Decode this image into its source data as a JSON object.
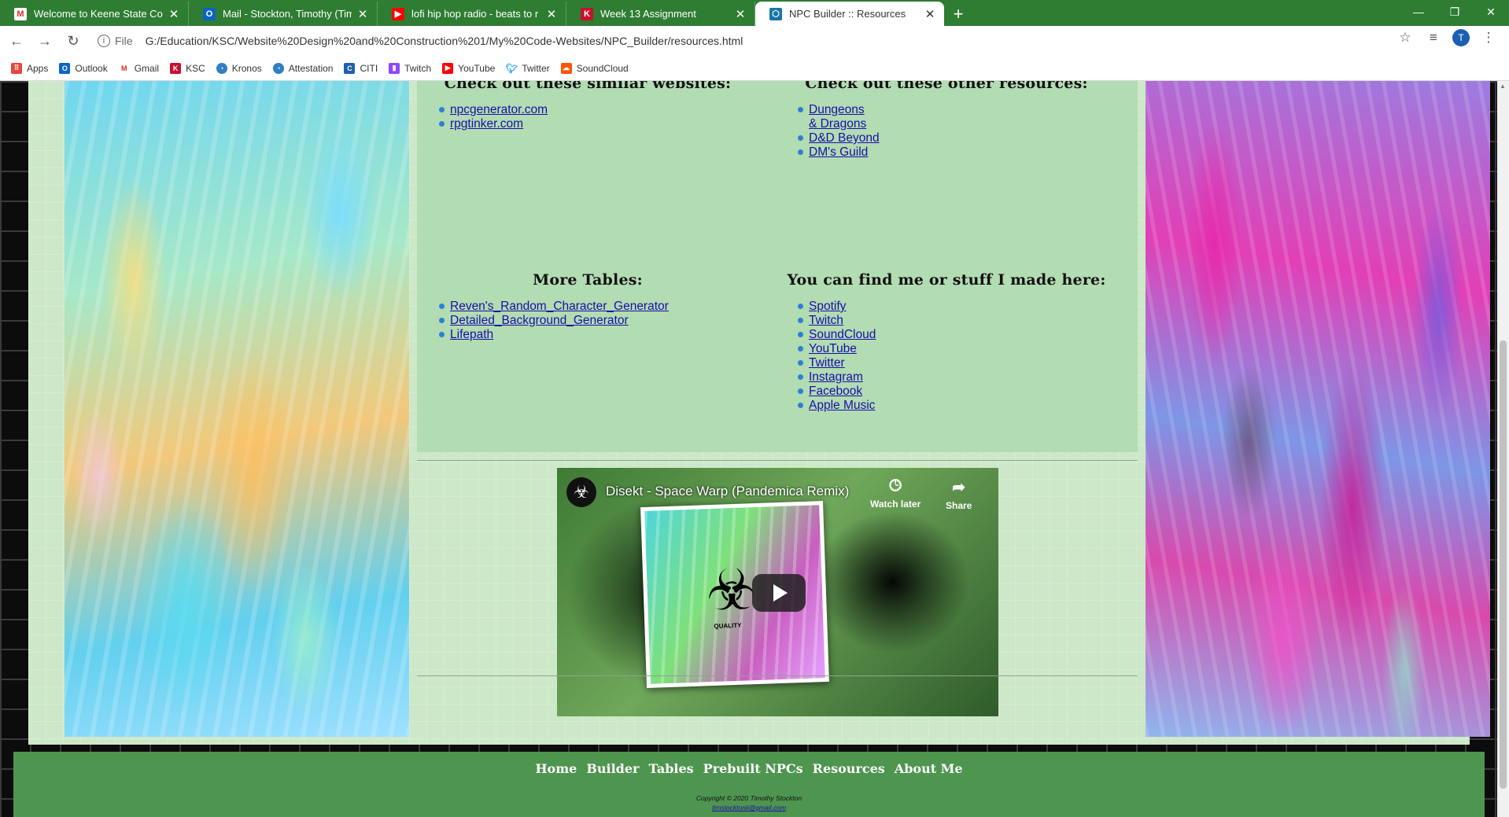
{
  "tabs": [
    {
      "title": "Welcome to Keene State College",
      "favicon": "gmail-icon",
      "color": "#d93025"
    },
    {
      "title": "Mail - Stockton, Timothy (Timoth",
      "favicon": "outlook-icon",
      "color": "#0a64c8"
    },
    {
      "title": "lofi hip hop radio - beats to r",
      "favicon": "youtube-icon",
      "color": "#ff0000"
    },
    {
      "title": "Week 13 Assignment",
      "favicon": "ksc-icon",
      "color": "#c8102e"
    },
    {
      "title": "NPC Builder :: Resources",
      "favicon": "npc-builder-icon",
      "color": "#1976a8",
      "active": true
    }
  ],
  "address": {
    "scheme": "File",
    "url": "G:/Education/KSC/Website%20Design%20and%20Construction%201/My%20Code-Websites/NPC_Builder/resources.html"
  },
  "profile_initial": "T",
  "bookmarks": [
    {
      "label": "Apps",
      "icon": "apps-grid-icon",
      "color": "#e8453c"
    },
    {
      "label": "Outlook",
      "icon": "outlook-icon",
      "color": "#0a64c8"
    },
    {
      "label": "Gmail",
      "icon": "gmail-icon",
      "color": "#d93025"
    },
    {
      "label": "KSC",
      "icon": "ksc-icon",
      "color": "#c8102e"
    },
    {
      "label": "Kronos",
      "icon": "kronos-icon",
      "color": "#2f7fc1"
    },
    {
      "label": "Attestation",
      "icon": "attestation-icon",
      "color": "#2f7fc1"
    },
    {
      "label": "CITI",
      "icon": "citi-icon",
      "color": "#1f5fb0"
    },
    {
      "label": "Twitch",
      "icon": "twitch-icon",
      "color": "#9146ff"
    },
    {
      "label": "YouTube",
      "icon": "youtube-icon",
      "color": "#ff0000"
    },
    {
      "label": "Twitter",
      "icon": "twitter-icon",
      "color": "#1da1f2"
    },
    {
      "label": "SoundCloud",
      "icon": "soundcloud-icon",
      "color": "#ff5500"
    }
  ],
  "sections": {
    "similar": {
      "heading": "Check out these similar websites:",
      "links": [
        "npcgenerator.com",
        "rpgtinker.com"
      ]
    },
    "other": {
      "heading": "Check out these other resources:",
      "links": [
        "Dungeons & Dragons",
        "D&D Beyond",
        "DM's Guild"
      ]
    },
    "tables": {
      "heading": "More Tables:",
      "links": [
        "Reven's_Random_Character_Generator",
        "Detailed_Background_Generator",
        "Lifepath"
      ]
    },
    "find_me": {
      "heading": "You can find me or stuff I made here:",
      "links": [
        "Spotify",
        "Twitch",
        "SoundCloud",
        "YouTube",
        "Twitter",
        "Instagram",
        "Facebook",
        "Apple Music"
      ]
    }
  },
  "video": {
    "title": "Disekt - Space Warp (Pandemica Remix)",
    "watch_later": "Watch later",
    "share": "Share",
    "thumb_text": "QUALITY"
  },
  "footer": {
    "nav": [
      "Home",
      "Builder",
      "Tables",
      "Prebuilt NPCs",
      "Resources",
      "About Me"
    ],
    "copyright": "Copyright © 2020 Timothy Stockton",
    "email": "timstocktonii@gmail.com"
  },
  "colors": {
    "chrome_green": "#2e7d32",
    "container_bg": "#cde8c8",
    "resources_bg": "#b2dcb1",
    "footer_bg": "#4e9550",
    "link": "#1a0dab"
  }
}
